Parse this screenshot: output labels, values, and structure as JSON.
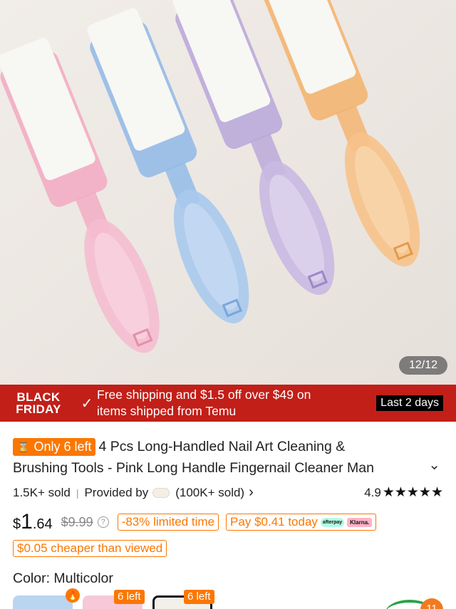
{
  "gallery": {
    "counter": "12/12"
  },
  "promo": {
    "badge_line1": "BLACK",
    "badge_line2": "FRIDAY",
    "text_line1": "Free shipping and $1.5 off over $49 on",
    "text_line2": "items shipped from Temu",
    "countdown": "Last 2 days"
  },
  "product": {
    "stock_badge": "Only 6 left",
    "title_line1": "4 Pcs Long-Handled Nail Art Cleaning &",
    "title_line2": "Brushing Tools - Pink Long Handle Fingernail Cleaner Man",
    "sold": "1.5K+ sold",
    "provided_by": "Provided by",
    "store_sold": "(100K+ sold)",
    "rating": "4.9",
    "stars": "★★★★★"
  },
  "price": {
    "currency": "$",
    "whole": "1",
    "cents": ".64",
    "original": "$9.99",
    "discount": "-83% limited time",
    "pay_today": "Pay $0.41 today",
    "afterpay": "afterpay",
    "klarna": "Klarna.",
    "cheaper": "$0.05 cheaper than viewed"
  },
  "options": {
    "color_label": "Color: Multicolor",
    "swatch_badge_2": "6 left",
    "swatch_badge_3": "6 left"
  },
  "cart": {
    "count": "11"
  },
  "icons": {
    "check": "✓",
    "hourglass": "⌛",
    "chevron_down": "⌄",
    "chevron_right": "›",
    "help": "?",
    "fire": "🔥"
  },
  "colors": {
    "brand_orange": "#fb7701",
    "promo_red": "#c21f18",
    "brush_pink": "#f2a9c3",
    "brush_blue": "#8fb9e8",
    "brush_purple": "#b9a6da",
    "brush_orange": "#f5b26b"
  }
}
